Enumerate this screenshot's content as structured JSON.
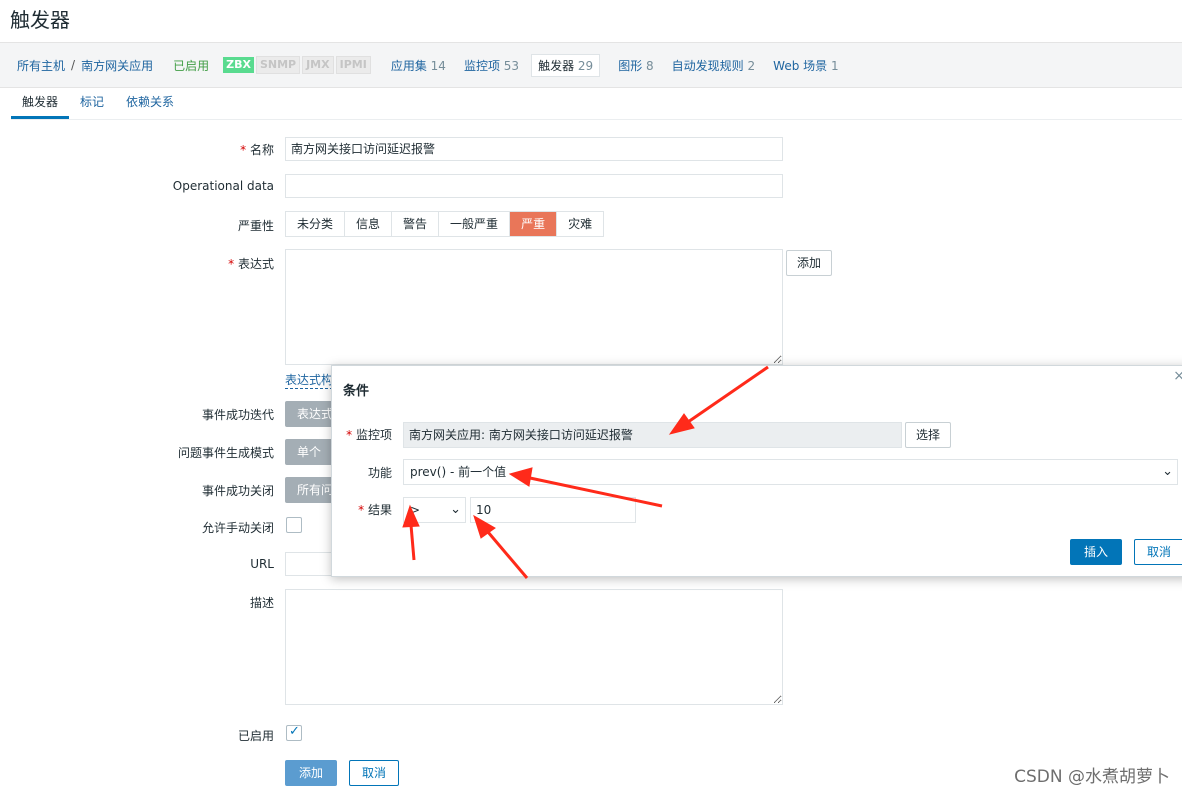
{
  "page": {
    "title": "触发器"
  },
  "host_nav": {
    "all_hosts": "所有主机",
    "separator": "/",
    "host": "南方网关应用",
    "status": "已启用",
    "tags": [
      "ZBX",
      "SNMP",
      "JMX",
      "IPMI"
    ],
    "links": [
      {
        "label": "应用集",
        "count": "14"
      },
      {
        "label": "监控项",
        "count": "53"
      },
      {
        "label": "触发器",
        "count": "29",
        "active": true
      },
      {
        "label": "图形",
        "count": "8"
      },
      {
        "label": "自动发现规则",
        "count": "2"
      },
      {
        "label": "Web 场景",
        "count": "1"
      }
    ]
  },
  "tabs": [
    "触发器",
    "标记",
    "依赖关系"
  ],
  "form": {
    "name_label": "名称",
    "name_value": "南方网关接口访问延迟报警",
    "opdata_label": "Operational data",
    "opdata_value": "",
    "severity_label": "严重性",
    "severities": [
      "未分类",
      "信息",
      "警告",
      "一般严重",
      "严重",
      "灾难"
    ],
    "severity_selected": "严重",
    "expression_label": "表达式",
    "expression_value": "",
    "add_label": "添加",
    "expr_constructor_link": "表达式构",
    "ok_event_label": "事件成功迭代",
    "ok_event_value": "表达式",
    "problem_mode_label": "问题事件生成模式",
    "problem_mode_value": "单个",
    "ok_close_label": "事件成功关闭",
    "ok_close_value": "所有问",
    "manual_close_label": "允许手动关闭",
    "manual_close_checked": false,
    "url_label": "URL",
    "url_value": "",
    "desc_label": "描述",
    "desc_value": "",
    "enabled_label": "已启用",
    "enabled_checked": true,
    "submit_label": "添加",
    "cancel_label": "取消"
  },
  "modal": {
    "title": "条件",
    "item_label": "监控项",
    "item_value": "南方网关应用: 南方网关接口访问延迟报警",
    "select_label": "选择",
    "function_label": "功能",
    "function_value": "prev() - 前一个值",
    "result_label": "结果",
    "operator_value": ">",
    "result_value": "10",
    "insert_label": "插入",
    "cancel_label": "取消"
  },
  "colors": {
    "accent": "#0275b8",
    "severity_high": "#e97659",
    "arrow": "#ff2a1a"
  },
  "watermark": "CSDN @水煮胡萝卜"
}
